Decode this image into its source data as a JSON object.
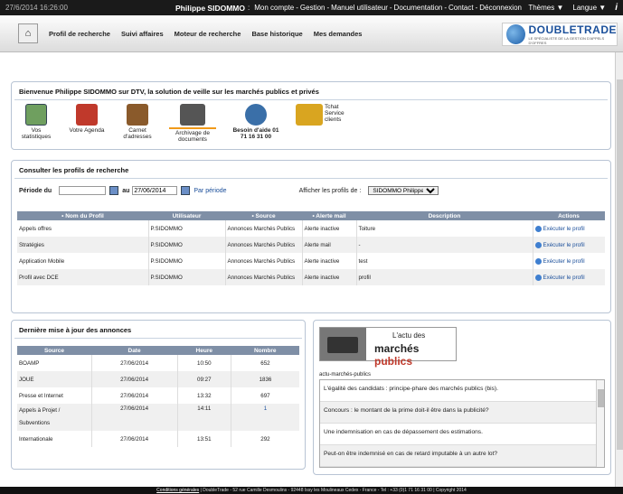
{
  "topbar": {
    "datetime": "27/6/2014 16:26:00",
    "user": "Philippe SIDOMMO",
    "links": [
      "Mon compte",
      "Gestion",
      "Manuel utilisateur",
      "Documentation",
      "Contact",
      "Déconnexion"
    ],
    "themes": "Thèmes ▼",
    "language": "Langue ▼",
    "info": "i"
  },
  "nav": {
    "items": [
      "Profil de recherche",
      "Suivi affaires",
      "Moteur de recherche",
      "Base historique",
      "Mes demandes"
    ]
  },
  "logo": {
    "brand": "DOUBLETRADE",
    "tagline": "LE SPÉCIALISTE DE LA GESTION D'APPELS D'OFFRES"
  },
  "welcome": {
    "title": "Bienvenue Philippe SIDOMMO sur DTV, la solution de veille sur les marchés publics et privés",
    "shortcuts": [
      {
        "label": "Vos statistiques",
        "icon": "chart-icon",
        "color": "#6f9f5f"
      },
      {
        "label": "Votre Agenda",
        "icon": "calendar-icon",
        "color": "#c0392b"
      },
      {
        "label": "Carnet d'adresses",
        "icon": "address-book-icon",
        "color": "#8a5a2b"
      },
      {
        "label": "Archivage de documents",
        "icon": "archive-icon",
        "color": "#555555"
      },
      {
        "label": "Besoin d'aide 01 71 16 31 00",
        "icon": "support-icon",
        "color": "#3a6fa8"
      },
      {
        "label": "Tchat Service clients",
        "icon": "chat-icon",
        "color": "#d9a520"
      }
    ]
  },
  "profiles": {
    "title": "Consulter les profils de recherche",
    "period_label": "Période du",
    "from": "",
    "to_label": "au",
    "to": "27/06/2014",
    "by_period": "Par période",
    "show_label": "Afficher les profils de :",
    "owner": "SIDOMMO Philippe",
    "columns": [
      "• Nom du Profil",
      "Utilisateur",
      "• Source",
      "• Alerte mail",
      "Description",
      "Actions"
    ],
    "rows": [
      [
        "Appels offres",
        "P.SIDOMMO",
        "Annonces Marchés Publics",
        "Alerte inactive",
        "Toiture",
        "Exécuter le profil"
      ],
      [
        "Stratégies",
        "P.SIDOMMO",
        "Annonces Marchés Publics",
        "Alerte mail",
        "-",
        "Exécuter le profil"
      ],
      [
        "Application Mobile",
        "P.SIDOMMO",
        "Annonces Marchés Publics",
        "Alerte inactive",
        "test",
        "Exécuter le profil"
      ],
      [
        "Profil avec DCE",
        "P.SIDOMMO",
        "Annonces Marchés Publics",
        "Alerte inactive",
        "profil",
        "Exécuter le profil"
      ]
    ]
  },
  "updates": {
    "title": "Dernière mise à jour des annonces",
    "columns": [
      "Source",
      "Date",
      "Heure",
      "Nombre"
    ],
    "rows": [
      [
        "BOAMP",
        "27/06/2014",
        "10:50",
        "652"
      ],
      [
        "JOUE",
        "27/06/2014",
        "09:27",
        "1836"
      ],
      [
        "Presse et Internet",
        "27/06/2014",
        "13:32",
        "697"
      ],
      [
        "Appels à Projet / Subventions",
        "27/06/2014",
        "14:11",
        "1"
      ],
      [
        "Internationale",
        "27/06/2014",
        "13:51",
        "292"
      ]
    ]
  },
  "actu": {
    "banner_line1": "L'actu des",
    "banner_line2a": "marchés ",
    "banner_line2b": "publics",
    "feed_label": "actu-marchés-publics",
    "items": [
      "L'égalité des candidats : principe-phare des marchés publics (bis).",
      "Concours : le montant de la prime doit-il être dans la publicité?",
      "Une indemnisation en cas de dépassement des estimations.",
      "Peut-on être indemnisé en cas de retard imputable à un autre lot?"
    ]
  },
  "footer": {
    "link": "Conditions générales",
    "text": " | DoubleTrade - 52 rue Camille Desmoulins - 92448 Issy les Moulineaux Cedex - France - Tel : +33 (0)1 71 16 31 00 | Copyright 2014"
  }
}
